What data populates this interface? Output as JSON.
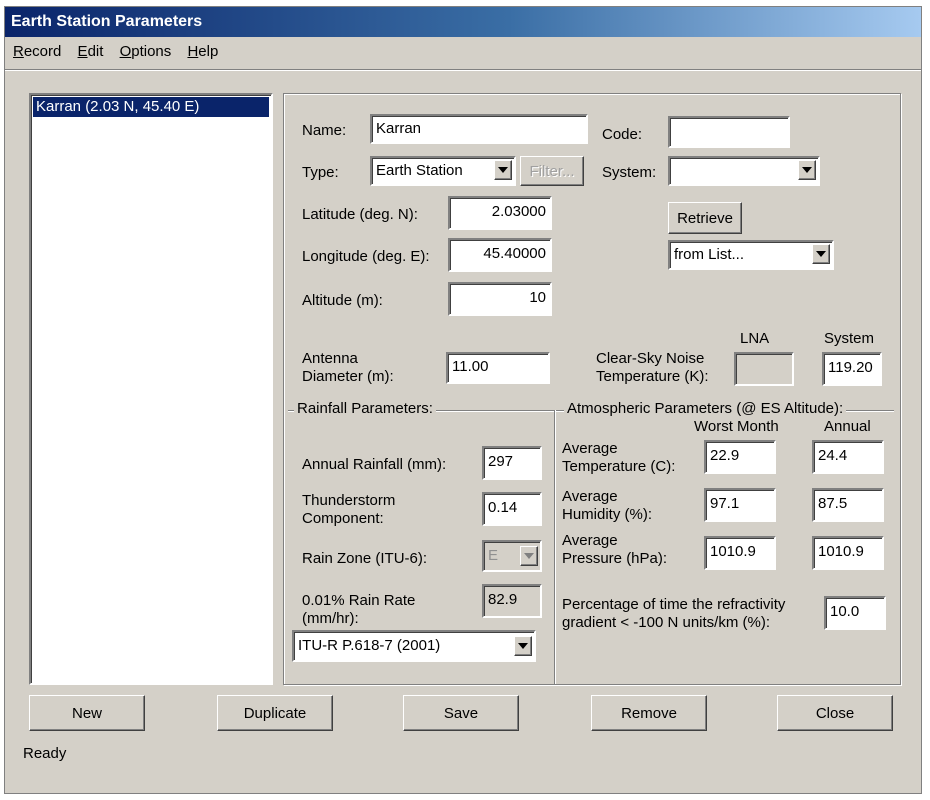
{
  "window": {
    "title": "Earth Station Parameters"
  },
  "menu": {
    "record": {
      "underline": "R",
      "rest": "ecord"
    },
    "edit": {
      "underline": "E",
      "rest": "dit"
    },
    "options": {
      "underline": "O",
      "rest": "ptions"
    },
    "help": {
      "underline": "H",
      "rest": "elp"
    }
  },
  "station_list": {
    "items": [
      "Karran (2.03 N, 45.40 E)"
    ],
    "selected": 0
  },
  "form": {
    "name_label": "Name:",
    "name_value": "Karran",
    "code_label": "Code:",
    "code_value": "",
    "type_label": "Type:",
    "type_value": "Earth Station",
    "filter_button": "Filter...",
    "system_label": "System:",
    "system_value": "",
    "latitude_label": "Latitude (deg. N):",
    "latitude_value": "2.03000",
    "longitude_label": "Longitude (deg. E):",
    "longitude_value": "45.40000",
    "altitude_label": "Altitude (m):",
    "altitude_value": "10",
    "retrieve_button": "Retrieve",
    "retrieve_source": "from List...",
    "antenna_label_1": "Antenna",
    "antenna_label_2": "Diameter (m):",
    "antenna_value": "11.00",
    "noise_label_1": "Clear-Sky Noise",
    "noise_label_2": "Temperature (K):",
    "noise_lna_header": "LNA",
    "noise_system_header": "System",
    "noise_lna_value": "",
    "noise_system_value": "119.20"
  },
  "rainfall": {
    "title": "Rainfall Parameters:",
    "annual_label": "Annual Rainfall (mm):",
    "annual_value": "297",
    "thunder_label_1": "Thunderstorm",
    "thunder_label_2": "Component:",
    "thunder_value": "0.14",
    "zone_label": "Rain Zone (ITU-6):",
    "zone_value": "E",
    "rate_label_1": "0.01% Rain Rate",
    "rate_label_2": "(mm/hr):",
    "rate_value": "82.9",
    "model_value": "ITU-R P.618-7 (2001)"
  },
  "atmospheric": {
    "title": "Atmospheric Parameters (@ ES Altitude):",
    "worst_header": "Worst Month",
    "annual_header": "Annual",
    "temp_label_1": "Average",
    "temp_label_2": "Temperature (C):",
    "temp_worst": "22.9",
    "temp_annual": "24.4",
    "hum_label_1": "Average",
    "hum_label_2": "Humidity (%):",
    "hum_worst": "97.1",
    "hum_annual": "87.5",
    "press_label_1": "Average",
    "press_label_2": "Pressure (hPa):",
    "press_worst": "1010.9",
    "press_annual": "1010.9",
    "refr_label_1": "Percentage of time the refractivity",
    "refr_label_2": "gradient < -100 N units/km (%):",
    "refr_value": "10.0"
  },
  "buttons": {
    "new": "New",
    "duplicate": "Duplicate",
    "save": "Save",
    "remove": "Remove",
    "close": "Close"
  },
  "status": {
    "text": "Ready"
  }
}
